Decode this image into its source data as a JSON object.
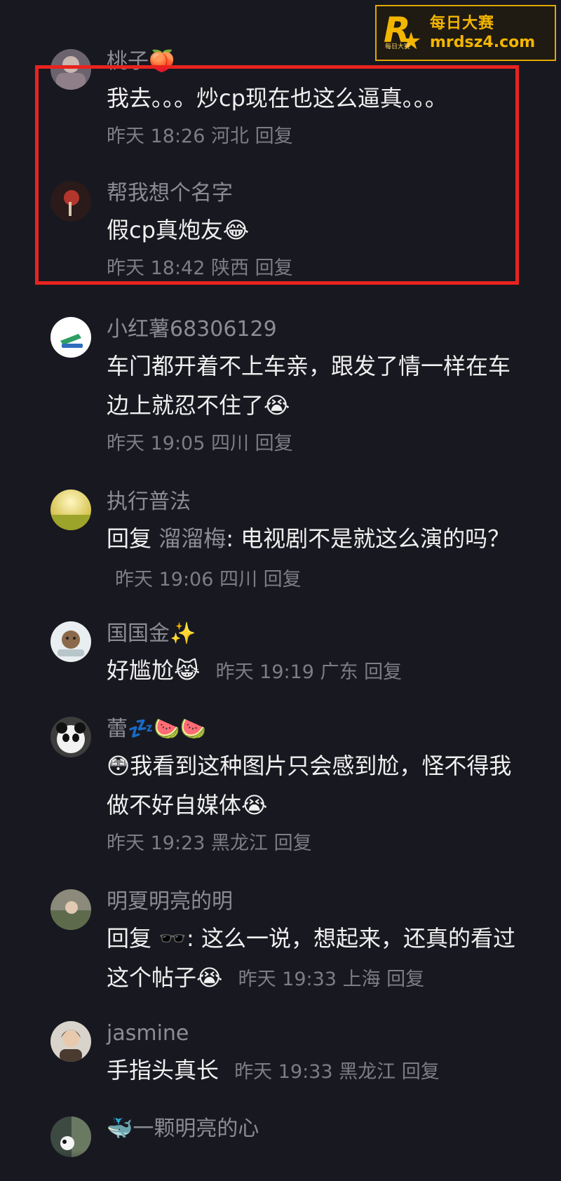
{
  "watermark": {
    "logo_letter": "R",
    "logo_small": "每日大赛",
    "title": "每日大赛",
    "url": "mrdsz4.com"
  },
  "colors": {
    "background": "#181820",
    "highlight": "#E8231F",
    "watermark": "#F3B600",
    "meta_text": "#7D7D86"
  },
  "comments": [
    {
      "name": "桃子🍑",
      "text": "我去。。。炒cp现在也这么逼真。。。",
      "time": "昨天 18:26",
      "location": "河北",
      "reply_label": "回复"
    },
    {
      "name": "帮我想个名字",
      "text": "假cp真炮友😂",
      "time": "昨天 18:42",
      "location": "陕西",
      "reply_label": "回复"
    },
    {
      "name": "小红薯68306129",
      "text": "车门都开着不上车亲，跟发了情一样在车边上就忍不住了😭",
      "time": "昨天 19:05",
      "location": "四川",
      "reply_label": "回复"
    },
    {
      "name": "执行普法",
      "text_prefix": "回复",
      "reply_to": "溜溜梅",
      "text": ": 电视剧不是就这么演的吗？",
      "time": "昨天 19:06",
      "location": "四川",
      "reply_label": "回复"
    },
    {
      "name": "国国金✨",
      "text": "好尴尬😹",
      "time": "昨天 19:19",
      "location": "广东",
      "reply_label": "回复"
    },
    {
      "name": "蕾💤🍉🍉",
      "text": "😳我看到这种图片只会感到尬，怪不得我做不好自媒体😭",
      "time": "昨天 19:23",
      "location": "黑龙江",
      "reply_label": "回复"
    },
    {
      "name": "明夏明亮的明",
      "text_prefix": "回复",
      "reply_to": "🕶️",
      "text": ": 这么一说，想起来，还真的看过这个帖子😭",
      "time": "昨天 19:33",
      "location": "上海",
      "reply_label": "回复"
    },
    {
      "name": "jasmine",
      "text": "手指头真长",
      "time": "昨天 19:33",
      "location": "黑龙江",
      "reply_label": "回复"
    },
    {
      "name": "🐳一颗明亮的心"
    }
  ]
}
